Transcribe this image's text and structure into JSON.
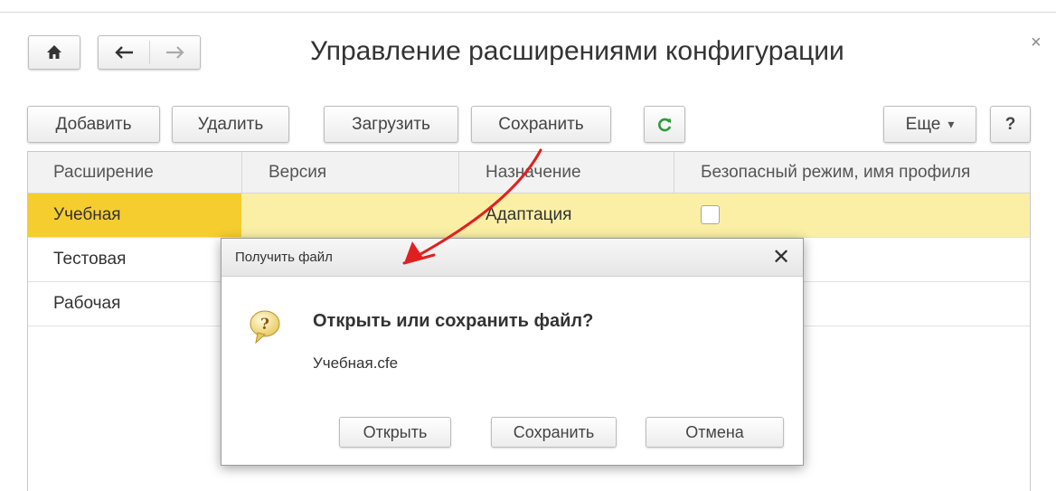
{
  "window": {
    "title": "Управление расширениями конфигурации",
    "close_glyph": "×"
  },
  "nav": {
    "home_icon": "home-icon",
    "back_icon": "arrow-left-icon",
    "forward_icon": "arrow-right-icon"
  },
  "toolbar": {
    "add_label": "Добавить",
    "delete_label": "Удалить",
    "load_label": "Загрузить",
    "save_label": "Сохранить",
    "refresh_icon": "refresh-icon",
    "more_label": "Еще",
    "more_glyph": "▾",
    "help_label": "?"
  },
  "table": {
    "columns": [
      "Расширение",
      "Версия",
      "Назначение",
      "Безопасный режим, имя профиля"
    ],
    "rows": [
      {
        "name": "Учебная",
        "version": "",
        "purpose": "Адаптация",
        "safe_mode": false,
        "selected": true
      },
      {
        "name": "Тестовая",
        "version": "",
        "purpose": "",
        "safe_mode": false,
        "selected": false
      },
      {
        "name": "Рабочая",
        "version": "",
        "purpose": "",
        "safe_mode": false,
        "selected": false
      }
    ]
  },
  "dialog": {
    "title": "Получить файл",
    "close_glyph": "✕",
    "question": "Открыть или сохранить файл?",
    "filename": "Учебная.cfe",
    "icon": "question-bubble-icon",
    "open_label": "Открыть",
    "save_label": "Сохранить",
    "cancel_label": "Отмена"
  },
  "colors": {
    "selected_row": "#fbefa5",
    "selected_cell": "#f5cd2f",
    "annotation_arrow": "#e02020",
    "refresh_icon": "#2e9a3a"
  }
}
